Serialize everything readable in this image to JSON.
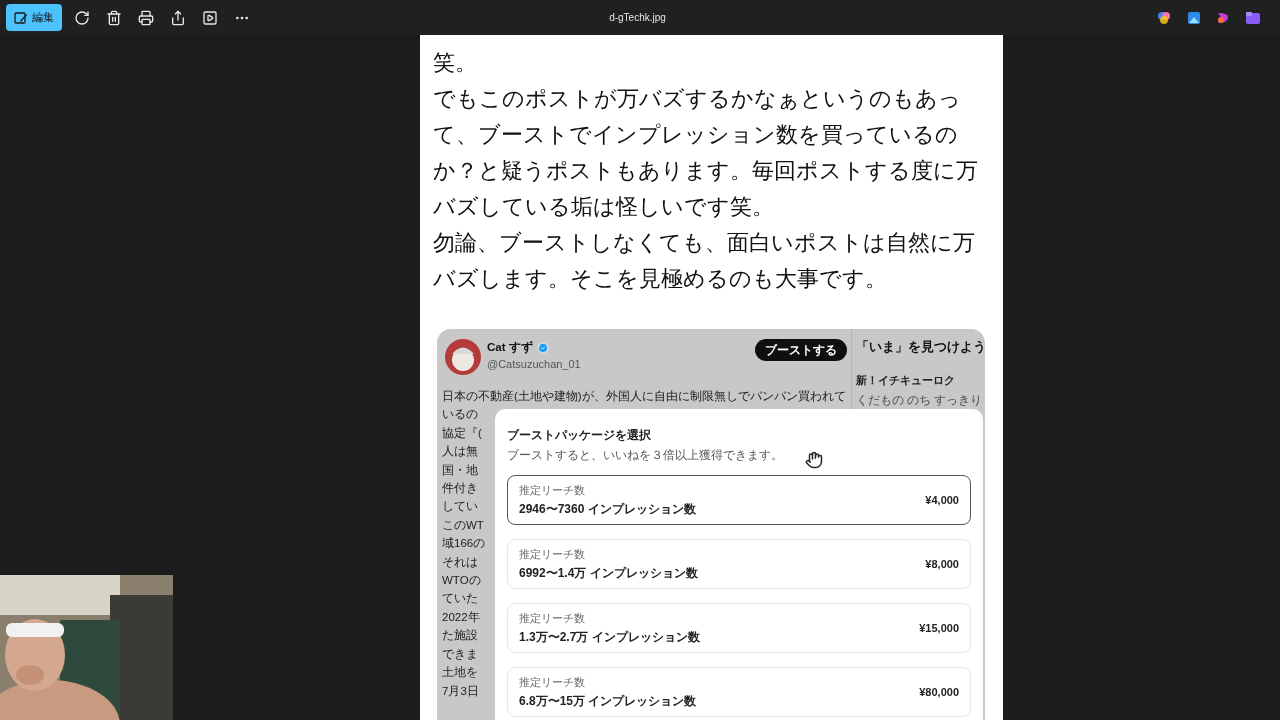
{
  "toolbar": {
    "edit_button": "編集",
    "file_name": "d-gTechk.jpg"
  },
  "article": {
    "paragraphs": [
      "笑。",
      "でもこのポストが万バズするかなぁというのもあって、ブーストでインプレッション数を買っているのか？と疑うポストもあります。毎回ポストする度に万バズしている垢は怪しいです笑。",
      "勿論、ブーストしなくても、面白いポストは自然に万バズします。そこを見極めるのも大事です。"
    ]
  },
  "post": {
    "name": "Cat すず",
    "verified": true,
    "handle": "@Catsuzuchan_01",
    "boost_button": "ブーストする",
    "first_line": "日本の不動産(土地や建物)が、外国人に自由に制限無しでバンバン買われて",
    "line_fragments": [
      "いるの",
      "協定『(",
      "人は無",
      "国・地",
      "件付き",
      "してい",
      "このWT",
      "域166の",
      "それは",
      "WTOの",
      "ていた",
      "2022年",
      "た施設",
      "できま",
      "土地を",
      "7月3日"
    ],
    "sidebar": {
      "title": "「いま」を見つけよう",
      "item_title": "新！イチキューロク",
      "item_text": "くだもの のち すっきり"
    }
  },
  "modal": {
    "title": "ブーストパッケージを選択",
    "subtitle": "ブーストすると、いいねを３倍以上獲得できます。",
    "options": [
      {
        "label": "推定リーチ数",
        "range": "2946〜7360 インプレッション数",
        "price": "¥4,000",
        "selected": true
      },
      {
        "label": "推定リーチ数",
        "range": "6992〜1.4万 インプレッション数",
        "price": "¥8,000",
        "selected": false
      },
      {
        "label": "推定リーチ数",
        "range": "1.3万〜2.7万 インプレッション数",
        "price": "¥15,000",
        "selected": false
      },
      {
        "label": "推定リーチ数",
        "range": "6.8万〜15万 インプレッション数",
        "price": "¥80,000",
        "selected": false
      }
    ]
  }
}
